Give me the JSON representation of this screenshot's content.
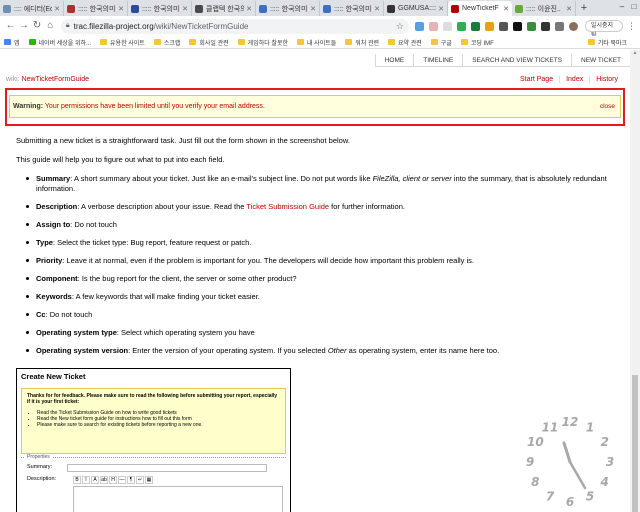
{
  "tabs": [
    {
      "title": ":::: 에디터(Ed",
      "color": "#6d8fb3",
      "active": false
    },
    {
      "title": "::::: 한국의미..",
      "color": "#a83232",
      "active": false
    },
    {
      "title": "::::: 한국의미..",
      "color": "#2b4aa0",
      "active": false
    },
    {
      "title": "클랩텍 한국의미..",
      "color": "#4a4a4a",
      "active": false
    },
    {
      "title": "::::: 한국의미..",
      "color": "#3a6fc4",
      "active": false
    },
    {
      "title": "::::: 한국의미..",
      "color": "#3a6fc4",
      "active": false
    },
    {
      "title": "GGMUSA::::..",
      "color": "#333333",
      "active": false
    },
    {
      "title": "NewTicketF",
      "color": "#b00000",
      "active": true
    },
    {
      "title": "::::: 이윤진..",
      "color": "#66aa33",
      "active": false
    }
  ],
  "browser": {
    "url_host": "trac.filezilla-project.org",
    "url_path": "/wiki/NewTicketFormGuide",
    "profile_label": "일시중지됨"
  },
  "bookmarks": [
    {
      "label": "앱",
      "folder": false
    },
    {
      "label": "네이버 세상을 위하...",
      "folder": false
    },
    {
      "label": "유용한 사이트",
      "folder": true
    },
    {
      "label": "스크랩",
      "folder": true
    },
    {
      "label": "회사일 관련",
      "folder": true
    },
    {
      "label": "게임하다 찰못한",
      "folder": true
    },
    {
      "label": "내 사이트들",
      "folder": true
    },
    {
      "label": "워처 관련",
      "folder": true
    },
    {
      "label": "요약 관련",
      "folder": true
    },
    {
      "label": "구글",
      "folder": true
    },
    {
      "label": "코딩 IMF",
      "folder": true
    }
  ],
  "bookmarks_other": "기타 북마크",
  "mainnav": [
    "HOME",
    "TIMELINE",
    "SEARCH AND VIEW TICKETS",
    "NEW TICKET"
  ],
  "ctxnav": {
    "prefix": "wiki:",
    "page": "NewTicketFormGuide",
    "links": [
      "Start Page",
      "Index",
      "History"
    ]
  },
  "warning": {
    "label": "Warning:",
    "text": "Your permissions have been limited until you",
    "link": "verify your email address",
    "end": ".",
    "close": "close"
  },
  "intro": [
    "Submitting a new ticket is a straightforward task. Just fill out the form shown in the screenshot below.",
    "This guide will help you to figure out what to put into each field."
  ],
  "fields": [
    {
      "name": "Summary",
      "text": ": A short summary about your ticket. Just like an e-mail's subject line. Do not put words like ",
      "em": "FileZilla, client or server",
      "tail": " into the summary, that is absolutely redundant information."
    },
    {
      "name": "Description",
      "text": ": A verbose description about your issue. Read the ",
      "link": "Ticket Submission Guide",
      "tail": " for further information."
    },
    {
      "name": "Assign to",
      "text": ": Do not touch"
    },
    {
      "name": "Type",
      "text": ": Select the ticket type: Bug report, feature request or patch."
    },
    {
      "name": "Priority",
      "text": ": Leave it at normal, even if the problem is important for you. The developers will decide how important this problem really is."
    },
    {
      "name": "Component",
      "text": ": Is the bug report for the client, the server or some other product?"
    },
    {
      "name": "Keywords",
      "text": ": A few keywords that will make finding your ticket easier."
    },
    {
      "name": "Cc",
      "text": ": Do not touch"
    },
    {
      "name": "Operating system type",
      "text": ": Select which operating system you have"
    },
    {
      "name": "Operating system version",
      "text": ": Enter the version of your operating system. If you selected ",
      "em": "Other",
      "tail": " as operating system, enter its name here too."
    }
  ],
  "screenshot": {
    "title": "Create New Ticket",
    "note_head": "Thanks for for feedback. Please make sure to read the following before submitting your report, especially if it is your first ticket:",
    "note_items": [
      "Read the Ticket Submission Guide on how to write good tickets",
      "Read the New ticket form guide for instructions how to fill out this form",
      "Please make sure to search for existing tickets before reporting a new one."
    ],
    "legend": "Properties",
    "summary_label": "Summary:",
    "description_label": "Description:",
    "toolbar": [
      "B",
      "I",
      "A",
      "ab",
      "H",
      "—",
      "¶",
      "↵",
      "▦"
    ]
  },
  "clock": {
    "numbers": [
      "12",
      "1",
      "2",
      "3",
      "4",
      "5",
      "6",
      "7",
      "8",
      "9",
      "10",
      "11"
    ],
    "hour": 11,
    "minute": 25
  }
}
